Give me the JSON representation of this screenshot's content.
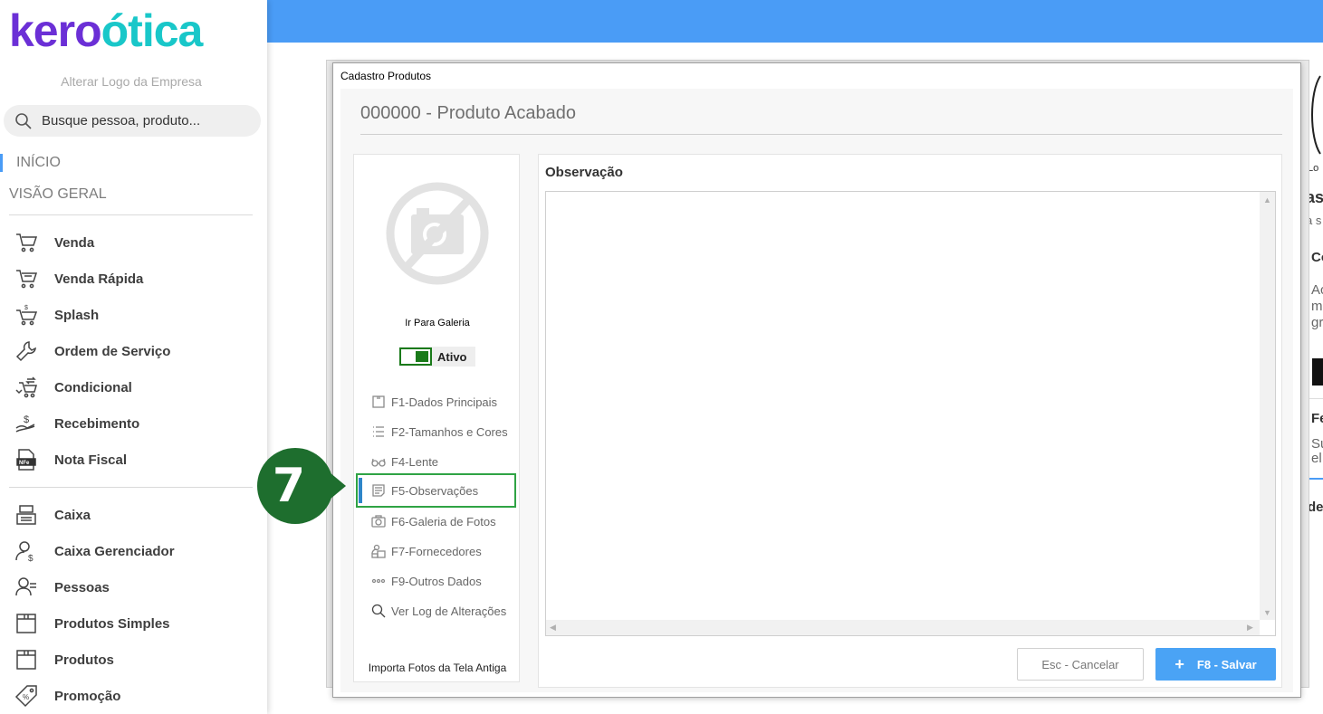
{
  "app": {
    "logo_left": "kero",
    "logo_right": "ótica",
    "change_logo": "Alterar Logo da Empresa",
    "search_placeholder": "Busque pessoa, produto...",
    "nav_inicio": "INÍCIO",
    "nav_visao_geral": "VISÃO GERAL",
    "brand_colors": {
      "purple": "#6b2fd6",
      "teal": "#19c7c9",
      "topbar": "#4a9cf6"
    }
  },
  "sidebar": {
    "group1": [
      {
        "label": "Venda",
        "icon": "cart-icon"
      },
      {
        "label": "Venda Rápida",
        "icon": "cart-fast-icon"
      },
      {
        "label": "Splash",
        "icon": "cart-dollar-icon"
      },
      {
        "label": "Ordem de Serviço",
        "icon": "wrench-icon"
      },
      {
        "label": "Condicional",
        "icon": "cart-exchange-icon"
      },
      {
        "label": "Recebimento",
        "icon": "hand-money-icon"
      },
      {
        "label": "Nota Fiscal",
        "icon": "nfe-icon"
      }
    ],
    "group2": [
      {
        "label": "Caixa",
        "icon": "cash-register-icon"
      },
      {
        "label": "Caixa Gerenciador",
        "icon": "user-dollar-icon"
      },
      {
        "label": "Pessoas",
        "icon": "people-icon"
      },
      {
        "label": "Produtos Simples",
        "icon": "box-icon"
      },
      {
        "label": "Produtos",
        "icon": "box-icon"
      },
      {
        "label": "Promoção",
        "icon": "tag-percent-icon"
      }
    ]
  },
  "dialog": {
    "window_title": "Cadastro Produtos",
    "product_title": "000000 - Produto Acabado",
    "gallery_link": "Ir Para Galeria",
    "toggle_label": "Ativo",
    "toggle_on": true,
    "tabs": [
      {
        "label": "F1-Dados Principais",
        "icon": "box-icon"
      },
      {
        "label": "F2-Tamanhos  e Cores",
        "icon": "list-icon"
      },
      {
        "label": "F4-Lente",
        "icon": "glasses-icon"
      },
      {
        "label": "F5-Observações",
        "icon": "note-icon",
        "active": true
      },
      {
        "label": "F6-Galeria de Fotos",
        "icon": "camera-icon"
      },
      {
        "label": "F7-Fornecedores",
        "icon": "supplier-icon"
      },
      {
        "label": "F9-Outros Dados",
        "icon": "dots-icon"
      },
      {
        "label": "Ver Log de Alterações",
        "icon": "search-icon"
      }
    ],
    "import_photos": "Importa Fotos da Tela Antiga",
    "section_title": "Observação",
    "observation_value": "",
    "cancel_label": "Esc - Cancelar",
    "save_label": "F8 - Salvar",
    "save_icon": "plus-icon"
  },
  "annotation": {
    "step": "7"
  },
  "background_partial": {
    "texts": [
      "Lo",
      "as",
      "a s",
      "Co",
      "Ac",
      "m",
      "gr",
      "Fe",
      "Su",
      "el",
      "de"
    ]
  }
}
